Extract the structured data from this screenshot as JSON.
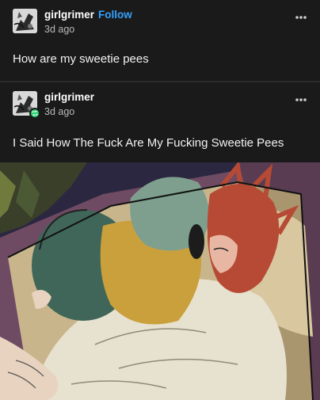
{
  "posts": [
    {
      "username": "girlgrimer",
      "follow_label": "Follow",
      "timestamp": "3d ago",
      "body": "How are my sweetie pees",
      "more_icon": "more-dots-icon"
    },
    {
      "username": "girlgrimer",
      "timestamp": "3d ago",
      "body": "I Said How The Fuck Are My Fucking Sweetie Pees",
      "reblog_icon": "reblog-icon",
      "more_icon": "more-dots-icon"
    }
  ],
  "colors": {
    "background": "#1a1a1a",
    "follow_blue": "#35a1ff",
    "reblog_green": "#2ccf72",
    "muted_text": "#b9b9b9"
  }
}
